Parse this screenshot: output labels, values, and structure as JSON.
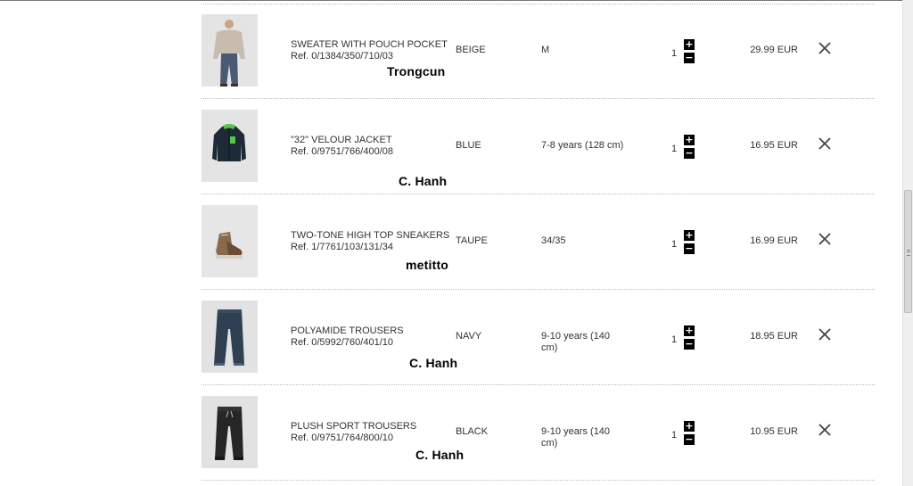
{
  "cart": {
    "items": [
      {
        "name": "SWEATER WITH POUCH POCKET",
        "ref": "Ref. 0/1384/350/710/03",
        "color": "BEIGE",
        "size": "M",
        "quantity": "1",
        "price": "29.99 EUR",
        "watermark": "Trongcun",
        "image_icon": "sweater-model-photo"
      },
      {
        "name": "\"32\" VELOUR JACKET",
        "ref": "Ref. 0/9751/766/400/08",
        "color": "BLUE",
        "size": "7-8 years (128 cm)",
        "quantity": "1",
        "price": "16.95 EUR",
        "watermark": "C. Hanh",
        "image_icon": "velour-jacket-photo"
      },
      {
        "name": "TWO-TONE HIGH TOP SNEAKERS",
        "ref": "Ref. 1/7761/103/131/34",
        "color": "TAUPE",
        "size": "34/35",
        "quantity": "1",
        "price": "16.99 EUR",
        "watermark": "metitto",
        "image_icon": "sneaker-photo"
      },
      {
        "name": "POLYAMIDE TROUSERS",
        "ref": "Ref. 0/5992/760/401/10",
        "color": "NAVY",
        "size": "9-10 years (140 cm)",
        "quantity": "1",
        "price": "18.95 EUR",
        "watermark": "C. Hanh",
        "image_icon": "trousers-photo"
      },
      {
        "name": "PLUSH SPORT TROUSERS",
        "ref": "Ref. 0/9751/764/800/10",
        "color": "BLACK",
        "size": "9-10 years (140 cm)",
        "quantity": "1",
        "price": "10.95 EUR",
        "watermark": "C. Hanh",
        "image_icon": "sport-trousers-photo"
      }
    ],
    "stepper": {
      "plus_label": "+",
      "minus_label": "−"
    },
    "remove_icon": "close-icon"
  },
  "colors": {
    "text": "#333333",
    "divider": "#bdbdbd",
    "stepper_bg": "#000000",
    "thumb_bg": "#e2e2e2"
  }
}
